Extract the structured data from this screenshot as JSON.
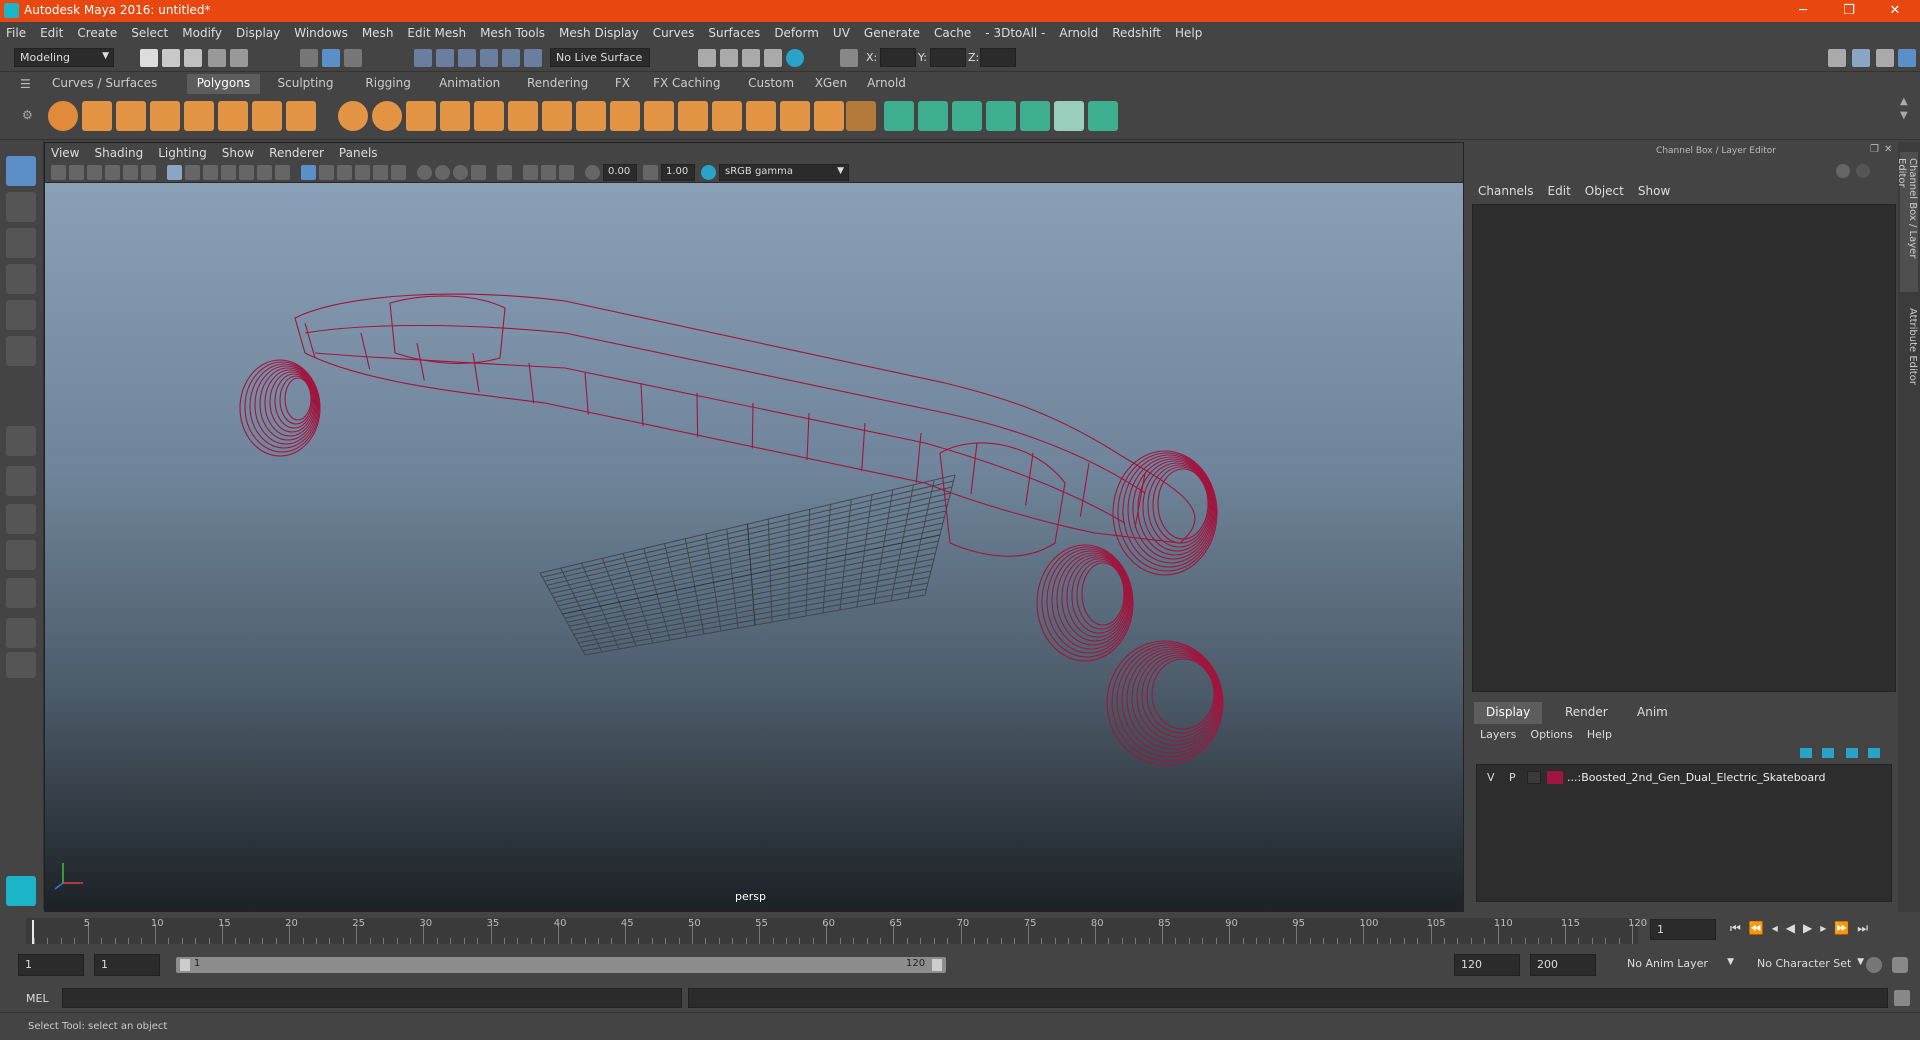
{
  "window": {
    "title": "Autodesk Maya 2016: untitled*"
  },
  "menus": [
    "File",
    "Edit",
    "Create",
    "Select",
    "Modify",
    "Display",
    "Windows",
    "Mesh",
    "Edit Mesh",
    "Mesh Tools",
    "Mesh Display",
    "Curves",
    "Surfaces",
    "Deform",
    "UV",
    "Generate",
    "Cache",
    "- 3DtoAll -",
    "Arnold",
    "Redshift",
    "Help"
  ],
  "status": {
    "mode": "Modeling",
    "live_surface": "No Live Surface",
    "x_label": "X:",
    "y_label": "Y:",
    "z_label": "Z:"
  },
  "shelf_tabs": [
    "Curves / Surfaces",
    "Polygons",
    "Sculpting",
    "Rigging",
    "Animation",
    "Rendering",
    "FX",
    "FX Caching",
    "Custom",
    "XGen",
    "Arnold"
  ],
  "shelf_active": "Polygons",
  "viewport": {
    "menu": [
      "View",
      "Shading",
      "Lighting",
      "Show",
      "Renderer",
      "Panels"
    ],
    "exposure": "0.00",
    "gamma": "1.00",
    "color_space": "sRGB gamma",
    "camera_label": "persp"
  },
  "channel_box": {
    "title": "Channel Box / Layer Editor",
    "menu": [
      "Channels",
      "Edit",
      "Object",
      "Show"
    ]
  },
  "layer_editor": {
    "tabs": [
      "Display",
      "Render",
      "Anim"
    ],
    "menu": [
      "Layers",
      "Options",
      "Help"
    ],
    "layer": {
      "v": "V",
      "p": "P",
      "name": "...:Boosted_2nd_Gen_Dual_Electric_Skateboard",
      "color": "#a0153e"
    }
  },
  "side_tabs": [
    "Channel Box / Layer Editor",
    "Attribute Editor"
  ],
  "timeline": {
    "ticks": [
      "5",
      "10",
      "15",
      "20",
      "25",
      "30",
      "35",
      "40",
      "45",
      "50",
      "55",
      "60",
      "65",
      "70",
      "75",
      "80",
      "85",
      "90",
      "95",
      "100",
      "105",
      "110",
      "115",
      "120"
    ],
    "start_label": "1",
    "current_frame": "1"
  },
  "range": {
    "start": "1",
    "playback_start": "1",
    "slider_start": "1",
    "slider_end": "120",
    "playback_end": "120",
    "end": "200",
    "anim_layer": "No Anim Layer",
    "character_set": "No Character Set"
  },
  "command": {
    "lang": "MEL"
  },
  "help": {
    "text": "Select Tool: select an object"
  },
  "colors": {
    "title_bar": "#e8470f",
    "wireframe": "#a0153e",
    "accent": "#5a8fc8"
  }
}
